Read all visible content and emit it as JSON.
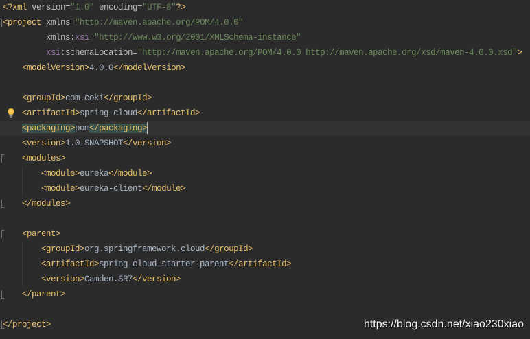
{
  "editor": {
    "lines": [
      {
        "tokens": [
          {
            "tag": "<?xml"
          },
          {
            "attr": " version="
          },
          {
            "value": "\"1.0\""
          },
          {
            "attr": " encoding="
          },
          {
            "value": "\"UTF-8\""
          },
          {
            "tag": "?>"
          }
        ]
      },
      {
        "fold_icon": "fold-open-icon",
        "tokens": [
          {
            "tag": "<project"
          },
          {
            "attr": " xmlns="
          },
          {
            "value": "\"http://maven.apache.org/POM/4.0.0\""
          }
        ]
      },
      {
        "tokens": [
          {
            "ws": "         "
          },
          {
            "attr": "xmlns:"
          },
          {
            "ns": "xsi"
          },
          {
            "attr": "="
          },
          {
            "value": "\"http://www.w3.org/2001/XMLSchema-instance\""
          }
        ]
      },
      {
        "tokens": [
          {
            "ws": "         "
          },
          {
            "ns": "xsi"
          },
          {
            "attr": ":schemaLocation="
          },
          {
            "value": "\"http://maven.apache.org/POM/4.0.0 http://maven.apache.org/xsd/maven-4.0.0.xsd\""
          },
          {
            "tag": ">"
          }
        ]
      },
      {
        "tokens": [
          {
            "ws": "    "
          },
          {
            "tag": "<modelVersion>"
          },
          {
            "text": "4.0.0"
          },
          {
            "tag": "</modelVersion>"
          }
        ]
      },
      {
        "tokens": []
      },
      {
        "tokens": [
          {
            "ws": "    "
          },
          {
            "tag": "<groupId>"
          },
          {
            "text": "com.coki"
          },
          {
            "tag": "</groupId>"
          }
        ]
      },
      {
        "gutter_icon": "lightbulb-icon",
        "tokens": [
          {
            "ws": "    "
          },
          {
            "tag": "<artifactId>"
          },
          {
            "text": "spring-cloud"
          },
          {
            "tag": "</artifactId>"
          }
        ]
      },
      {
        "current": true,
        "caret": true,
        "tokens": [
          {
            "ws": "    "
          },
          {
            "tag": "<packaging>",
            "match": true
          },
          {
            "text": "pom"
          },
          {
            "tag": "</packaging>",
            "match": true
          }
        ]
      },
      {
        "tokens": [
          {
            "ws": "    "
          },
          {
            "tag": "<version>"
          },
          {
            "text": "1.0-SNAPSHOT"
          },
          {
            "tag": "</version>"
          }
        ]
      },
      {
        "fold_icon": "fold-open-icon",
        "tokens": [
          {
            "ws": "    "
          },
          {
            "tag": "<modules>"
          }
        ]
      },
      {
        "tokens": [
          {
            "ws": "        "
          },
          {
            "tag": "<module>"
          },
          {
            "text": "eureka"
          },
          {
            "tag": "</module>"
          }
        ]
      },
      {
        "tokens": [
          {
            "ws": "        "
          },
          {
            "tag": "<module>"
          },
          {
            "text": "eureka-client"
          },
          {
            "tag": "</module>"
          }
        ]
      },
      {
        "fold_icon": "fold-close-icon",
        "tokens": [
          {
            "ws": "    "
          },
          {
            "tag": "</modules>"
          }
        ]
      },
      {
        "tokens": []
      },
      {
        "fold_icon": "fold-open-icon",
        "tokens": [
          {
            "ws": "    "
          },
          {
            "tag": "<parent>"
          }
        ]
      },
      {
        "tokens": [
          {
            "ws": "        "
          },
          {
            "tag": "<groupId>"
          },
          {
            "text": "org.springframework.cloud"
          },
          {
            "tag": "</groupId>"
          }
        ]
      },
      {
        "tokens": [
          {
            "ws": "        "
          },
          {
            "tag": "<artifactId>"
          },
          {
            "text": "spring-cloud-starter-parent"
          },
          {
            "tag": "</artifactId>"
          }
        ]
      },
      {
        "tokens": [
          {
            "ws": "        "
          },
          {
            "tag": "<version>"
          },
          {
            "text": "Camden.SR7"
          },
          {
            "tag": "</version>"
          }
        ]
      },
      {
        "fold_icon": "fold-close-icon",
        "tokens": [
          {
            "ws": "    "
          },
          {
            "tag": "</parent>"
          }
        ]
      },
      {
        "tokens": []
      },
      {
        "fold_icon": "fold-close-icon",
        "tokens": [
          {
            "tag": "</project>"
          }
        ]
      }
    ]
  },
  "watermark": "https://blog.csdn.net/xiao230xiao",
  "colors": {
    "background": "#2b2b2b",
    "current-line": "#323232",
    "tag": "#e8bf6a",
    "attribute": "#bababa",
    "namespace": "#9876aa",
    "value": "#6a8759",
    "text": "#a9b7c6",
    "match-background": "#3b514d",
    "caret": "#bbbbbb",
    "lightbulb": "#f0c040",
    "watermark": "#f2f2f2"
  }
}
